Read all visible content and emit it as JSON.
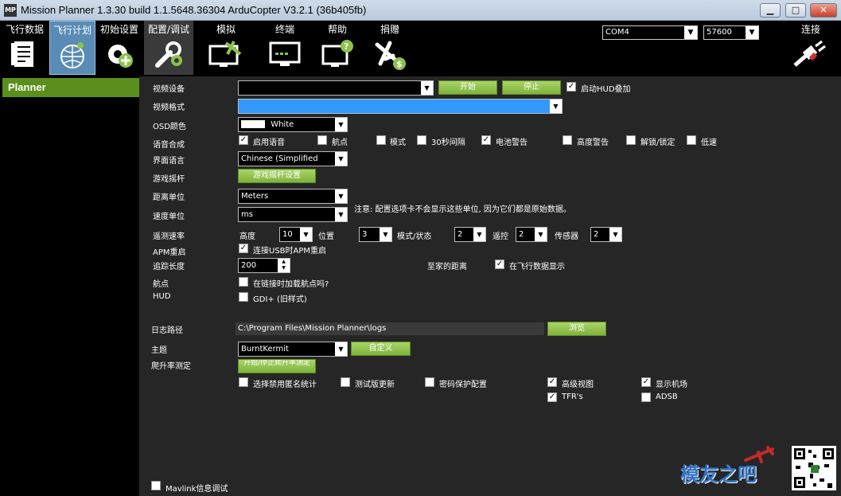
{
  "window": {
    "title": "Mission Planner 1.3.30 build 1.1.5648.36304 ArduCopter V3.2.1 (36b405fb)",
    "logo": "MP",
    "min": "▁",
    "max": "□",
    "close": "✕"
  },
  "menu": [
    {
      "label": "飞行数据",
      "icon": "flight-data-icon"
    },
    {
      "label": "飞行计划",
      "icon": "flight-plan-icon"
    },
    {
      "label": "初始设置",
      "icon": "initial-setup-icon"
    },
    {
      "label": "配置/调试",
      "icon": "config-tuning-icon"
    },
    {
      "label": "模拟",
      "icon": "simulation-icon"
    },
    {
      "label": "终端",
      "icon": "terminal-icon"
    },
    {
      "label": "帮助",
      "icon": "help-icon"
    },
    {
      "label": "捐赠",
      "icon": "donate-icon"
    }
  ],
  "connection": {
    "port": "COM4",
    "baud": "57600",
    "connect_label": "连接"
  },
  "sidebar": {
    "tab": "Planner"
  },
  "video": {
    "device_label": "视频设备",
    "device_value": "",
    "start": "开始",
    "stop": "停止",
    "hud_overlay": "启动HUD叠加",
    "format_label": "视频格式",
    "format_value": ""
  },
  "osd": {
    "label": "OSD颜色",
    "value": "White"
  },
  "speech": {
    "label": "语音合成",
    "items": [
      "启用语音",
      "航点",
      "模式",
      "30秒间隔",
      "电池警告",
      "高度警告",
      "解锁/锁定",
      "低速"
    ],
    "checked": [
      true,
      false,
      false,
      false,
      true,
      false,
      false,
      false
    ]
  },
  "ui_language": {
    "label": "界面语言",
    "value": "Chinese (Simplified"
  },
  "joystick": {
    "label": "游戏摇杆",
    "button": "游戏摇杆设置"
  },
  "distance": {
    "label": "距离单位",
    "value": "Meters"
  },
  "speed": {
    "label": "速度单位",
    "value": "ms"
  },
  "units_note": "注意: 配置选项卡不会显示这些单位, 因为它们都是原始数据。",
  "telemetry": {
    "label": "遥测速率",
    "altitude_label": "高度",
    "altitude_value": "10",
    "position_label": "位置",
    "position_value": "3",
    "mode_label": "模式/状态",
    "mode_value": "2",
    "rc_label": "遥控",
    "rc_value": "2",
    "sensor_label": "传感器",
    "sensor_value": "2"
  },
  "apm_reset": {
    "label": "APM重启",
    "option": "连接USB时APM重启"
  },
  "track_length": {
    "label": "追踪长度",
    "value": "200"
  },
  "home_distance": {
    "label": "至家的距离",
    "option": "在飞行数据显示"
  },
  "waypoints": {
    "label": "航点",
    "option": "在链接时加载航点吗?"
  },
  "hud": {
    "label": "HUD",
    "option": "GDI+ (旧样式)"
  },
  "log": {
    "label": "日志路径",
    "path": "C:\\Program Files\\Mission Planner\\logs",
    "browse": "浏览"
  },
  "theme": {
    "label": "主题",
    "value": "BurntKermit",
    "custom": "自定义"
  },
  "climb": {
    "label": "爬升率测定",
    "button": "开始/停止爬升率测定"
  },
  "options": {
    "anon_stats": "选择禁用匿名统计",
    "beta_updates": "测试版更新",
    "password": "密码保护配置",
    "advanced_view": "高级视图",
    "show_airports": "显示机场",
    "tfr": "TFR's",
    "adsb": "ADSB"
  },
  "mavlink_debug": "Mavlink信息调试",
  "watermark": "模友之吧"
}
